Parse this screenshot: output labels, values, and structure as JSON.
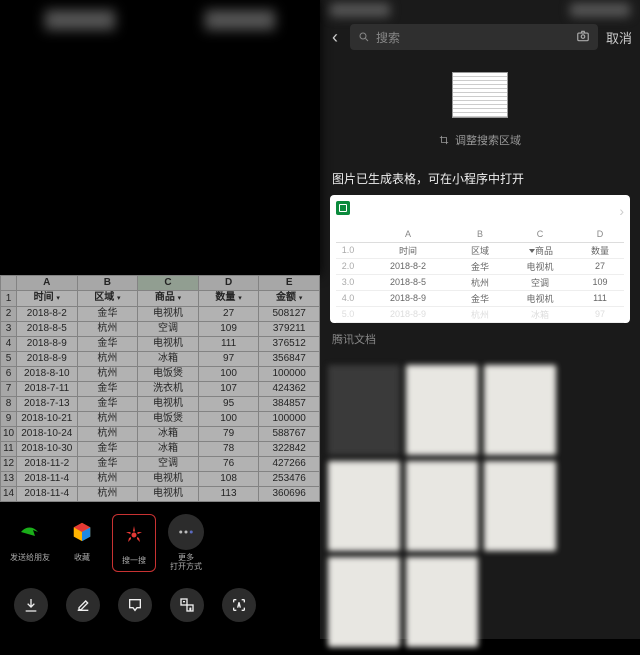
{
  "left": {
    "spreadsheet": {
      "col_letters": [
        "A",
        "B",
        "C",
        "D",
        "E"
      ],
      "selected_col": "C",
      "headers": [
        "时间",
        "区域",
        "商品",
        "数量",
        "金额"
      ],
      "rows": [
        [
          "2018-8-2",
          "金华",
          "电视机",
          "27",
          "508127"
        ],
        [
          "2018-8-5",
          "杭州",
          "空调",
          "109",
          "379211"
        ],
        [
          "2018-8-9",
          "金华",
          "电视机",
          "111",
          "376512"
        ],
        [
          "2018-8-9",
          "杭州",
          "冰箱",
          "97",
          "356847"
        ],
        [
          "2018-8-10",
          "杭州",
          "电饭煲",
          "100",
          "100000"
        ],
        [
          "2018-7-11",
          "金华",
          "洗衣机",
          "107",
          "424362"
        ],
        [
          "2018-7-13",
          "金华",
          "电视机",
          "95",
          "384857"
        ],
        [
          "2018-10-21",
          "杭州",
          "电饭煲",
          "100",
          "100000"
        ],
        [
          "2018-10-24",
          "杭州",
          "冰箱",
          "79",
          "588767"
        ],
        [
          "2018-10-30",
          "金华",
          "冰箱",
          "78",
          "322842"
        ],
        [
          "2018-11-2",
          "金华",
          "空调",
          "76",
          "427266"
        ],
        [
          "2018-11-4",
          "杭州",
          "电视机",
          "108",
          "253476"
        ],
        [
          "2018-11-4",
          "杭州",
          "电视机",
          "113",
          "360696"
        ]
      ]
    },
    "share": {
      "send": "发送给朋友",
      "collect": "收藏",
      "scan": "搜一搜",
      "more": "更多\n打开方式"
    }
  },
  "right": {
    "search_placeholder": "搜索",
    "cancel": "取消",
    "adjust": "调整搜索区域",
    "result_note": "图片已生成表格，可在小程序中打开",
    "provider": "腾讯文档",
    "mini_cols": [
      "A",
      "B",
      "C",
      "D"
    ],
    "mini_headers": [
      "时间",
      "区域",
      "商品",
      "数量"
    ],
    "mini_rows": [
      {
        "n": "1.0",
        "cells": [
          "时间",
          "区域",
          "商品",
          "数量"
        ]
      },
      {
        "n": "2.0",
        "cells": [
          "2018-8-2",
          "金华",
          "电视机",
          "27"
        ]
      },
      {
        "n": "3.0",
        "cells": [
          "2018-8-5",
          "杭州",
          "空调",
          "109"
        ]
      },
      {
        "n": "4.0",
        "cells": [
          "2018-8-9",
          "金华",
          "电视机",
          "111"
        ]
      },
      {
        "n": "5.0",
        "cells": [
          "2018-8-9",
          "杭州",
          "冰箱",
          "97"
        ]
      }
    ]
  }
}
